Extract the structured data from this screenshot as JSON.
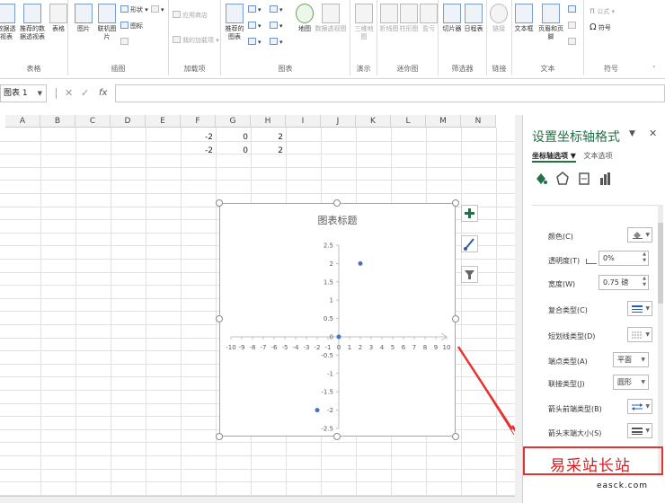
{
  "ribbon": {
    "groups": [
      {
        "name": "表格",
        "buttons": [
          "数据透视表",
          "推荐的数据透视表",
          "表格"
        ]
      },
      {
        "name": "插图",
        "buttons": [
          "图片",
          "联机图片",
          "形状",
          "图标"
        ]
      },
      {
        "name": "加载项",
        "buttons": [
          "应用商店",
          "我的加载项"
        ]
      },
      {
        "name": "图表",
        "buttons": [
          "推荐的图表",
          "地图",
          "数据透视图"
        ]
      },
      {
        "name": "演示",
        "buttons": [
          "三维地图"
        ]
      },
      {
        "name": "迷你图",
        "buttons": [
          "折线图",
          "柱形图",
          "盈亏"
        ]
      },
      {
        "name": "筛选器",
        "buttons": [
          "切片器",
          "日程表"
        ]
      },
      {
        "name": "链接",
        "buttons": [
          "链接"
        ]
      },
      {
        "name": "文本",
        "buttons": [
          "文本框",
          "页眉和页脚"
        ]
      },
      {
        "name": "符号",
        "buttons": [
          "公式",
          "符号"
        ]
      }
    ]
  },
  "formula_bar": {
    "name_box": "图表 1",
    "cancel": "✕",
    "enter": "✓",
    "fx": "fx"
  },
  "sheet": {
    "columns": [
      "A",
      "B",
      "C",
      "D",
      "E",
      "F",
      "G",
      "H",
      "I",
      "J",
      "K",
      "L",
      "M",
      "N"
    ],
    "rows": [
      {
        "F": "-2",
        "G": "0",
        "H": "2"
      },
      {
        "F": "-2",
        "G": "0",
        "H": "2"
      }
    ]
  },
  "chart_data": {
    "type": "scatter",
    "title": "图表标题",
    "x_ticks": [
      -10,
      -9,
      -8,
      -7,
      -6,
      -5,
      -4,
      -3,
      -2,
      -1,
      0,
      1,
      2,
      3,
      4,
      5,
      6,
      7,
      8,
      9,
      10
    ],
    "y_ticks": [
      2.5,
      2,
      1.5,
      1,
      0.5,
      0,
      -0.5,
      -1,
      -1.5,
      -2,
      -2.5
    ],
    "xlim": [
      -10,
      10
    ],
    "ylim": [
      -2.5,
      2.5
    ],
    "series": [
      {
        "points": [
          {
            "x": -2,
            "y": -2
          },
          {
            "x": 0,
            "y": 0
          },
          {
            "x": 2,
            "y": 2
          }
        ]
      }
    ],
    "grid": false,
    "legend": "none",
    "axis_arrow": true,
    "marker_color": "#4472c4"
  },
  "chart_tools": [
    "plus-icon",
    "brush-icon",
    "filter-icon"
  ],
  "pane": {
    "title": "设置坐标轴格式",
    "tab_axis": "坐标轴选项",
    "tab_text": "文本选项",
    "props": [
      {
        "label": "颜色(C)"
      },
      {
        "label": "透明度(T)",
        "value": "0%"
      },
      {
        "label": "宽度(W)",
        "value": "0.75 磅"
      },
      {
        "label": "复合类型(C)"
      },
      {
        "label": "短划线类型(D)"
      },
      {
        "label": "端点类型(A)",
        "value": "平面"
      },
      {
        "label": "联接类型(J)",
        "value": "圆形"
      },
      {
        "label": "箭头前端类型(B)"
      },
      {
        "label": "箭头末端大小(S)"
      }
    ]
  },
  "colors": {
    "accent": "#217346",
    "highlight": "#e53333",
    "series": "#4472c4"
  },
  "watermark": {
    "text": "易采站长站",
    "url": "easck.com"
  }
}
